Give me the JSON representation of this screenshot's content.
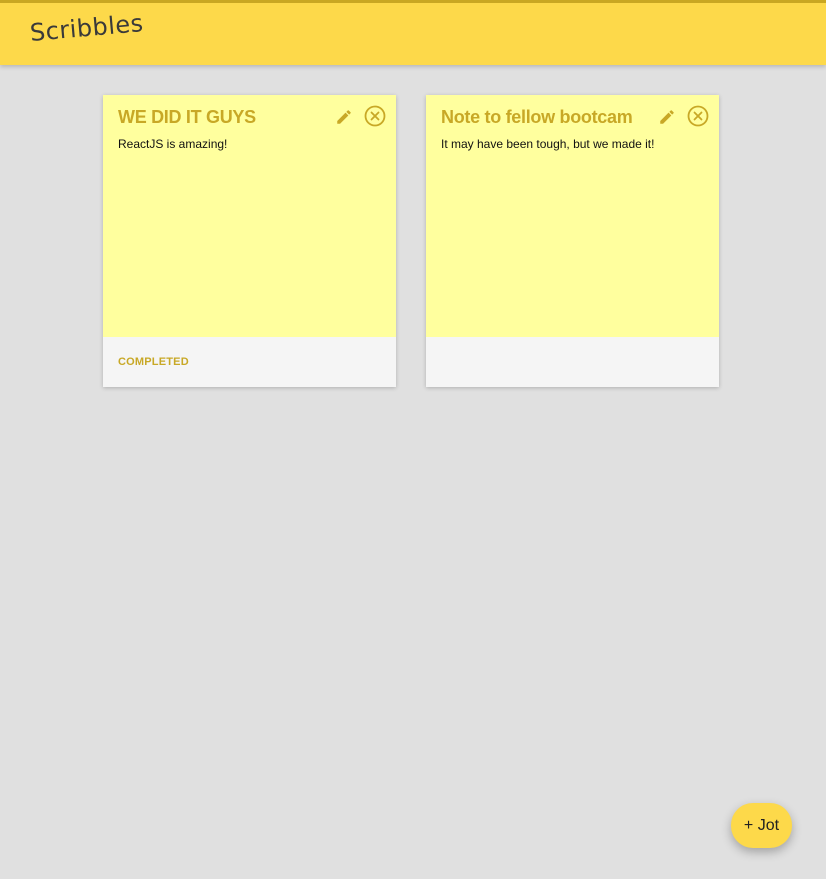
{
  "app": {
    "title": "Scribbles",
    "accent_color": "#fdd94a",
    "note_color": "#ffff9e"
  },
  "notes": [
    {
      "title": "WE DID IT GUYS",
      "body": "ReactJS is amazing!",
      "status": "COMPLETED",
      "edit_icon": "pencil-icon",
      "delete_icon": "close-circle-icon"
    },
    {
      "title": "Note to fellow bootcam",
      "body": "It may have been tough, but we made it!",
      "status": "",
      "edit_icon": "pencil-icon",
      "delete_icon": "close-circle-icon"
    }
  ],
  "fab": {
    "label": "+ Jot"
  }
}
